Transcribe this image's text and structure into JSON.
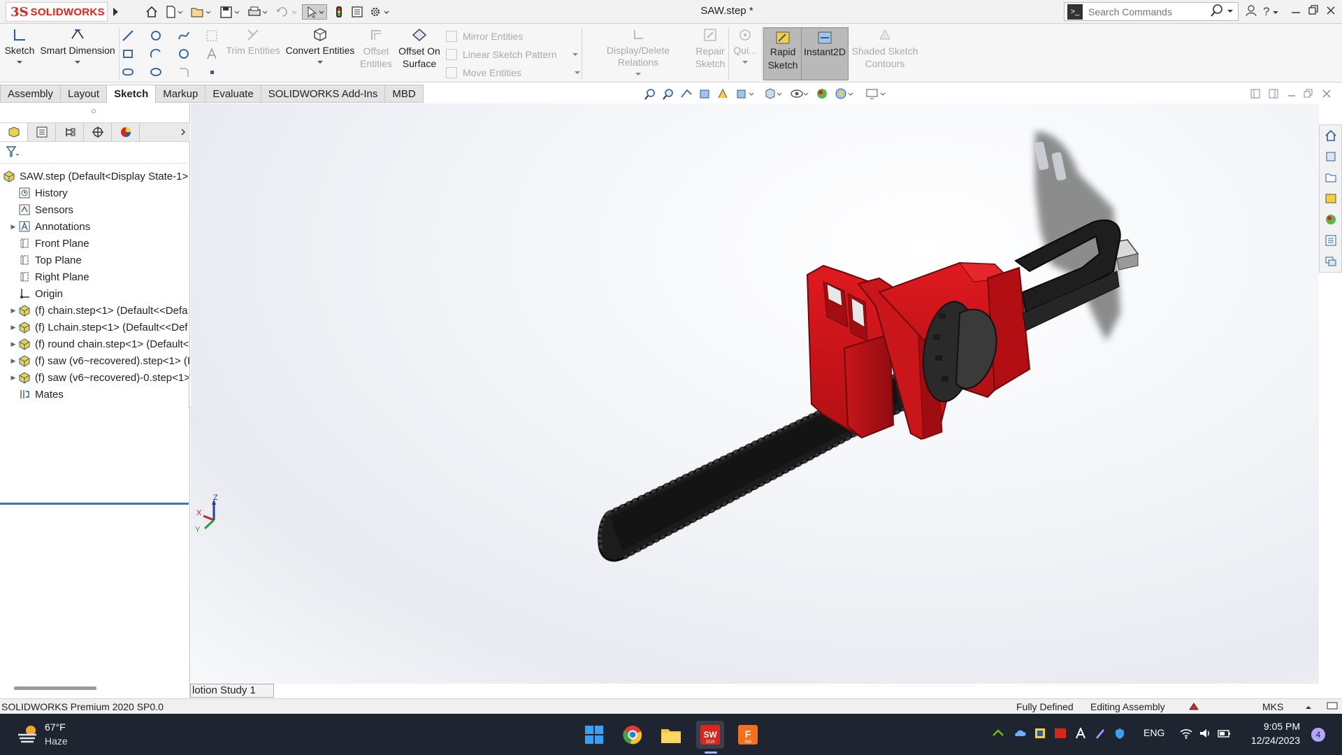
{
  "titlebar": {
    "logo_ds": "3S",
    "logo_text": "SOLIDWORKS",
    "window_title": "SAW.step *",
    "search_placeholder": "Search Commands",
    "help_label": "?"
  },
  "commandmanager": {
    "sketch": "Sketch",
    "smart_dimension": "Smart Dimension",
    "trim_entities": "Trim Entities",
    "convert_entities": "Convert Entities",
    "offset_entities_1": "Offset",
    "offset_entities_2": "Entities",
    "offset_on_surface_1": "Offset On",
    "offset_on_surface_2": "Surface",
    "mirror_entities": "Mirror Entities",
    "linear_sketch_pattern": "Linear Sketch Pattern",
    "move_entities": "Move Entities",
    "display_delete_relations": "Display/Delete Relations",
    "repair_sketch_1": "Repair",
    "repair_sketch_2": "Sketch",
    "quick_snaps": "Qui...",
    "rapid_sketch_1": "Rapid",
    "rapid_sketch_2": "Sketch",
    "instant2d": "Instant2D",
    "shaded_contours_1": "Shaded Sketch",
    "shaded_contours_2": "Contours"
  },
  "tabs": [
    "Assembly",
    "Layout",
    "Sketch",
    "Markup",
    "Evaluate",
    "SOLIDWORKS Add-Ins",
    "MBD"
  ],
  "active_tab": "Sketch",
  "tree": {
    "root": "SAW.step  (Default<Display State-1>",
    "items": [
      {
        "label": "History"
      },
      {
        "label": "Sensors"
      },
      {
        "label": "Annotations"
      },
      {
        "label": "Front Plane"
      },
      {
        "label": "Top Plane"
      },
      {
        "label": "Right Plane"
      },
      {
        "label": "Origin"
      },
      {
        "label": "(f) chain.step<1> (Default<<Defa"
      },
      {
        "label": "(f) Lchain.step<1> (Default<<Def"
      },
      {
        "label": "(f) round chain.step<1> (Default<"
      },
      {
        "label": "(f) saw (v6~recovered).step<1> (I"
      },
      {
        "label": "(f) saw (v6~recovered)-0.step<1>"
      },
      {
        "label": "Mates"
      }
    ]
  },
  "triad": {
    "x": "X",
    "y": "Y",
    "z": "Z"
  },
  "motion_tab": "lotion Study 1",
  "status": {
    "product": "SOLIDWORKS Premium 2020 SP0.0",
    "defined": "Fully Defined",
    "mode": "Editing Assembly",
    "units": "MKS"
  },
  "taskbar": {
    "weather_temp": "67°F",
    "weather_desc": "Haze",
    "lang": "ENG",
    "time": "9:05 PM",
    "date": "12/24/2023",
    "notifications": "4",
    "sw_badge": "SW",
    "sw_year": "2020",
    "f360_badge": "F",
    "f360_year": "360"
  },
  "colors": {
    "brand_red": "#e2231a",
    "saw_body": "#d4161b",
    "saw_dark": "#1e1e1e",
    "selection_blue": "#3a78b5"
  }
}
